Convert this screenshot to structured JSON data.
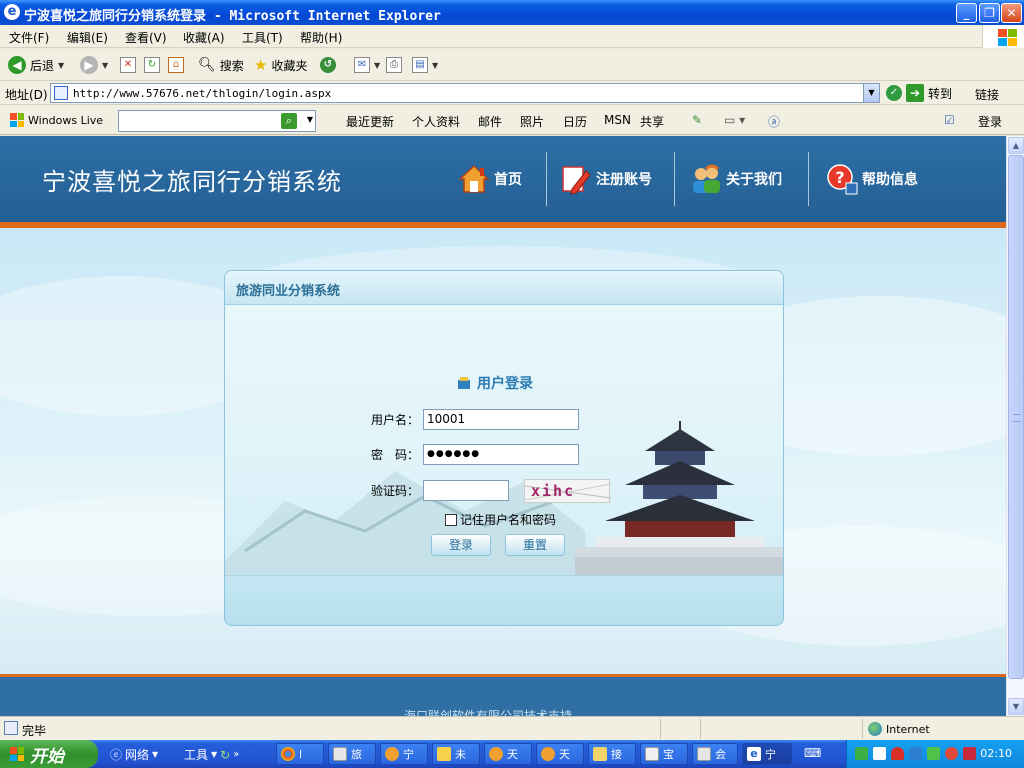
{
  "window": {
    "title": "宁波喜悦之旅同行分销系统登录 - Microsoft Internet Explorer"
  },
  "menu": [
    "文件(F)",
    "编辑(E)",
    "查看(V)",
    "收藏(A)",
    "工具(T)",
    "帮助(H)"
  ],
  "toolbar": {
    "back": "后退",
    "search": "搜索",
    "favorites": "收藏夹"
  },
  "address": {
    "label": "地址(D)",
    "url": "http://www.57676.net/thlogin/login.aspx",
    "go": "转到",
    "links": "链接"
  },
  "live": {
    "brand": "Windows Live",
    "search_value": "",
    "links": [
      "最近更新",
      "个人资料",
      "邮件",
      "照片",
      "日历",
      "MSN",
      "共享"
    ],
    "login": "登录"
  },
  "site": {
    "title": "宁波喜悦之旅同行分销系统",
    "nav": [
      "首页",
      "注册账号",
      "关于我们",
      "帮助信息"
    ]
  },
  "panel": {
    "header": "旅游同业分销系统",
    "login_title": "用户登录",
    "username_label": "用户名：",
    "username_value": "10001",
    "password_label": "密　码：",
    "password_value": "●●●●●●",
    "captcha_label": "验证码：",
    "captcha_value": "",
    "captcha_text": "xihc",
    "remember_label": "记住用户名和密码",
    "login_btn": "登录",
    "reset_btn": "重置"
  },
  "footer": {
    "text": "海口联创软件有限公司技术支持"
  },
  "status": {
    "text": "完毕",
    "zone": "Internet"
  },
  "taskbar": {
    "start": "开始",
    "quick": [
      "网络",
      "工具"
    ],
    "tasks": [
      "l",
      "旅",
      "宁",
      "未",
      "天",
      "天",
      "接",
      "宝",
      "会",
      "宁"
    ],
    "clock": "02:10"
  },
  "colors": {
    "header_blue": "#2c6fa6",
    "accent_orange": "#e06a1c",
    "panel_text": "#2d6f95"
  }
}
